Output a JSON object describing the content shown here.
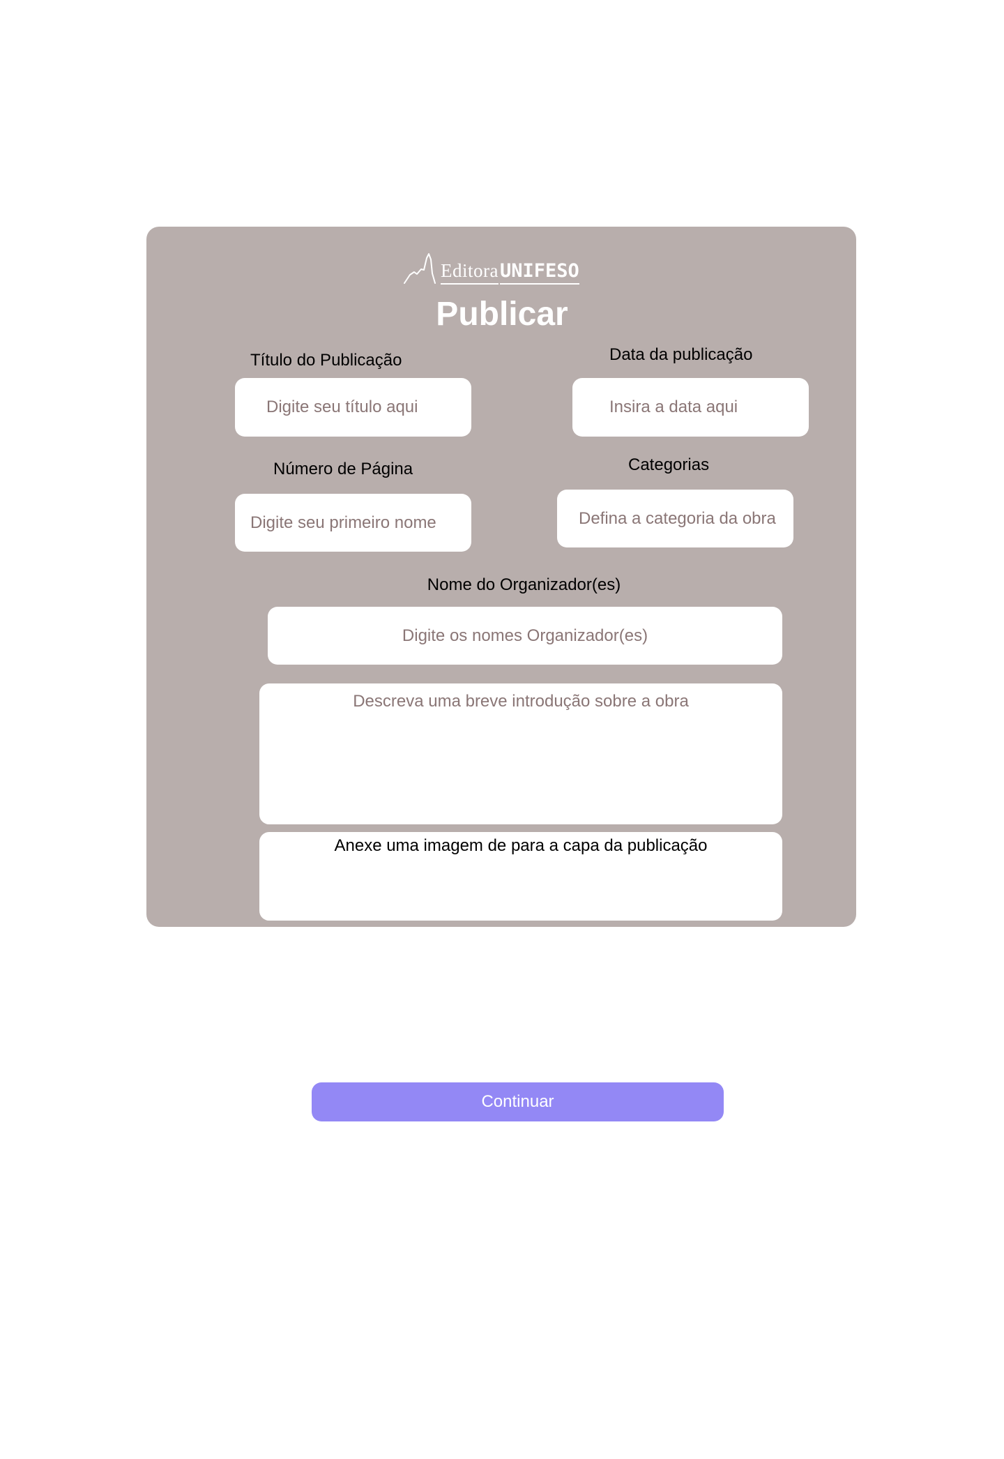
{
  "brand": {
    "light": "Editora",
    "bold": "UNIFESO",
    "logo_icon": "mountain-icon"
  },
  "page_title": "Publicar",
  "form": {
    "title_field": {
      "label": "Título do Publicação",
      "placeholder": "Digite seu título aqui"
    },
    "date_field": {
      "label": "Data da publicação",
      "placeholder": "Insira a data aqui"
    },
    "pages_field": {
      "label": "Número de Página",
      "placeholder": "Digite seu primeiro nome"
    },
    "category_field": {
      "label": "Categorias",
      "placeholder": "Defina a categoria da obra"
    },
    "organizer_field": {
      "label": "Nome do Organizador(es)",
      "placeholder": "Digite os nomes Organizador(es)"
    },
    "intro_field": {
      "placeholder": "Descreva uma breve introdução sobre a obra"
    },
    "cover_upload": {
      "label": "Anexe uma imagem de para a capa da publicação"
    }
  },
  "actions": {
    "continue_label": "Continuar"
  },
  "colors": {
    "card_background": "#b8aeac",
    "button_background": "#9388f5",
    "placeholder_text": "#8a7676"
  }
}
